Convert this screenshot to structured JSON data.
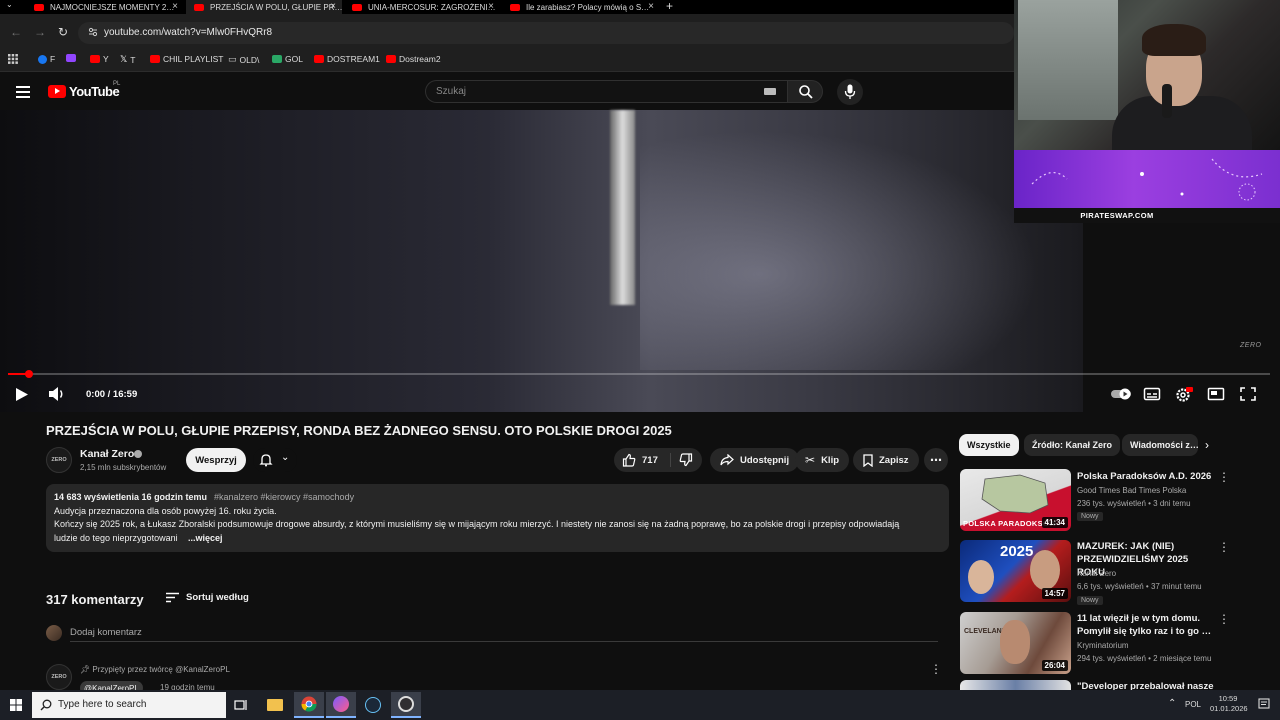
{
  "browser": {
    "tabs": [
      {
        "label": "NAJMOCNIEJSZE MOMENTY 2…",
        "active": false
      },
      {
        "label": "PRZEJŚCIA W POLU, GŁUPIE PR…",
        "active": true
      },
      {
        "label": "UNIA-MERCOSUR: ZAGROŻENI…",
        "active": false
      },
      {
        "label": "Ile zarabiasz? Polacy mówią o S…",
        "active": false
      }
    ],
    "url": "youtube.com/watch?v=Mlw0FHvQRr8",
    "bookmarks": [
      "F",
      "Y",
      "T",
      "CHIL PLAYLIST",
      "OLD\\",
      "GOL",
      "DOSTREAM1",
      "Dostream2"
    ]
  },
  "youtube": {
    "wordmark": "YouTube",
    "region": "PL",
    "search_placeholder": "Szukaj"
  },
  "player": {
    "time": "0:00 / 16:59",
    "progress_fraction": 0.017,
    "watermark": "ZERO"
  },
  "overlay": {
    "banner_text": "PIRATESWAP.COM"
  },
  "video": {
    "title": "PRZEJŚCIA W POLU, GŁUPIE PRZEPISY, RONDA BEZ ŻADNEGO SENSU. OTO POLSKIE DROGI 2025",
    "channel": "Kanał Zero",
    "channel_avatar": "ZERO",
    "subscribers": "2,15 mln subskrybentów",
    "support_label": "Wesprzyj",
    "likes": "717",
    "share_label": "Udostępnij",
    "clip_label": "Klip",
    "save_label": "Zapisz"
  },
  "description": {
    "stats": "14 683 wyświetlenia  16 godzin temu",
    "tags": "#kanalzero #kierowcy #samochody",
    "line1": "Audycja przeznaczona dla osób powyżej 16. roku życia.",
    "line2": "Kończy się 2025 rok, a Łukasz Zboralski podsumowuje drogowe absurdy, z którymi musieliśmy się w mijającym roku mierzyć. I niestety nie zanosi się na żadną poprawę, bo za polskie drogi i przepisy odpowiadają",
    "line3": "ludzie do tego nieprzygotowani",
    "more": "...więcej"
  },
  "comments": {
    "count": "317 komentarzy",
    "sort_label": "Sortuj według",
    "add_placeholder": "Dodaj komentarz",
    "pinned_by": "Przypięty przez twórcę @KanalZeroPL",
    "pinned_author": "@KanalZeroPL",
    "pinned_time": "19 godzin temu",
    "pinned_avatar": "ZERO"
  },
  "sidebar": {
    "chips": [
      "Wszystkie",
      "Źródło: Kanał Zero",
      "Wiadomości z…"
    ],
    "videos": [
      {
        "title": "Polska Paradoksów A.D. 2026",
        "channel": "Good Times Bad Times Polska",
        "meta": "236 tys. wyświetleń • 3 dni temu",
        "badge": "Nowy",
        "duration": "41:34",
        "thumb_text": "POLSKA PARADOKSÓW"
      },
      {
        "title": "MAZUREK: JAK (NIE) PRZEWIDZIELIŚMY 2025 ROKU",
        "channel": "Kanał Zero",
        "meta": "6,6 tys. wyświetleń • 37 minut temu",
        "badge": "Nowy",
        "duration": "14:57",
        "thumb_text": "2025"
      },
      {
        "title": "11 lat więził je w tym domu. Pomylił się tylko raz i to go …",
        "channel": "Kryminatorium",
        "meta": "294 tys. wyświetleń • 2 miesiące temu",
        "badge": "",
        "duration": "26:04",
        "thumb_text": "CLEVELAND"
      },
      {
        "title": "\"Developer przebalował nasze",
        "channel": "",
        "meta": "",
        "badge": "",
        "duration": "",
        "thumb_text": ""
      }
    ]
  },
  "taskbar": {
    "search_placeholder": "Type here to search",
    "lang": "POL",
    "time": "10:59",
    "date": "01.01.2026"
  },
  "colors": {
    "youtube_red": "#ff0000",
    "background": "#0f0f0f",
    "chip_bg": "#272727",
    "banner_purple": "#8a35d8"
  }
}
